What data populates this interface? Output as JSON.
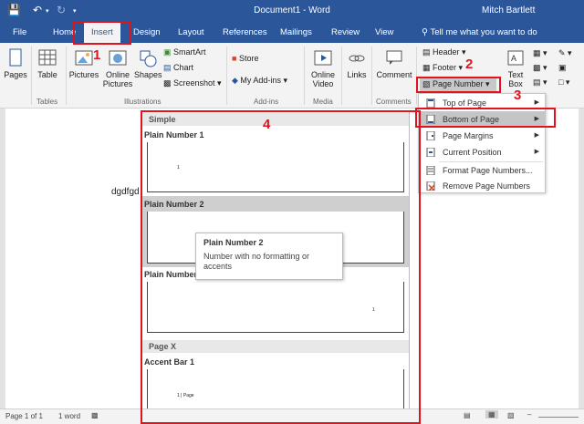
{
  "window": {
    "title": "Document1 - Word",
    "user": "Mitch Bartlett"
  },
  "tabs": [
    "File",
    "Home",
    "Insert",
    "Design",
    "Layout",
    "References",
    "Mailings",
    "Review",
    "View"
  ],
  "tell_me": "Tell me what you want to do",
  "ribbon": {
    "pages": "Pages",
    "table": "Table",
    "pictures": "Pictures",
    "online_pictures": "Online Pictures",
    "shapes": "Shapes",
    "smartart": "SmartArt",
    "chart": "Chart",
    "screenshot": "Screenshot",
    "store": "Store",
    "my_addins": "My Add-ins",
    "online_video": "Online Video",
    "links": "Links",
    "comment": "Comment",
    "header": "Header",
    "footer": "Footer",
    "page_number": "Page Number",
    "text_box": "Text Box",
    "groups": {
      "tables": "Tables",
      "illustrations": "Illustrations",
      "addins": "Add-ins",
      "media": "Media",
      "comments": "Comments"
    }
  },
  "document": {
    "text": "dgdfgd"
  },
  "gallery": {
    "section_simple": "Simple",
    "plain1": "Plain Number 1",
    "plain2": "Plain Number 2",
    "plain3": "Plain Number",
    "section_pagex": "Page X",
    "accent1": "Accent Bar 1",
    "num1": "1",
    "num3": "1",
    "accent_text": "1 | Page"
  },
  "tooltip": {
    "title": "Plain Number 2",
    "body": "Number with no formatting or accents"
  },
  "submenu": [
    "Top of Page",
    "Bottom of Page",
    "Page Margins",
    "Current Position",
    "Format Page Numbers...",
    "Remove Page Numbers"
  ],
  "status": {
    "page": "Page 1 of 1",
    "words": "1 word"
  },
  "annotations": [
    "1",
    "2",
    "3",
    "4"
  ],
  "colors": {
    "word_blue": "#2b579a",
    "annotation_red": "#e0141e"
  }
}
